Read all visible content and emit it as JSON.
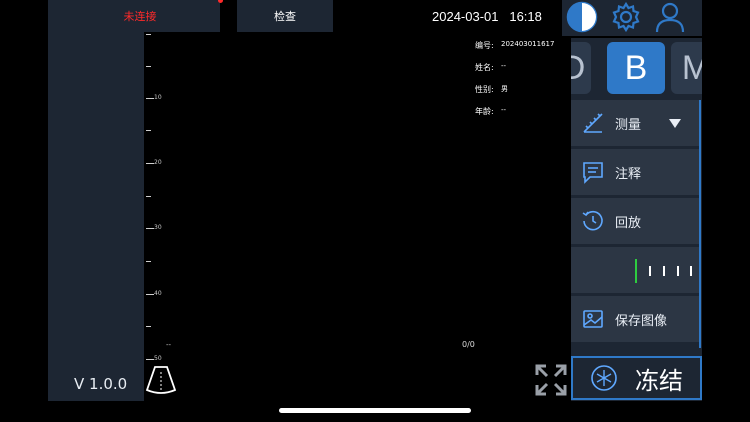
{
  "header": {
    "connection_status": "未连接",
    "exam_tab": "检查",
    "date": "2024-03-01",
    "time": "16:18"
  },
  "ruler": {
    "labels": [
      "10",
      "20",
      "30",
      "40",
      "50"
    ],
    "bottom_marker": "--"
  },
  "patient": {
    "id_label": "编号:",
    "id_value": "202403011617",
    "name_label": "姓名:",
    "name_value": "--",
    "gender_label": "性别:",
    "gender_value": "男",
    "age_label": "年龄:",
    "age_value": "--"
  },
  "frame_counter": "0/0",
  "version": "V 1.0.0",
  "mode_tabs": [
    "D",
    "B",
    "M"
  ],
  "active_mode": "B",
  "menu": {
    "measure": "测量",
    "annotate": "注释",
    "playback": "回放",
    "save_image": "保存图像"
  },
  "freeze_label": "冻结",
  "colors": {
    "accent": "#2f79c8",
    "panel": "#1d2633",
    "status_red": "#ff2a2a",
    "cine_green": "#2ecc40"
  }
}
